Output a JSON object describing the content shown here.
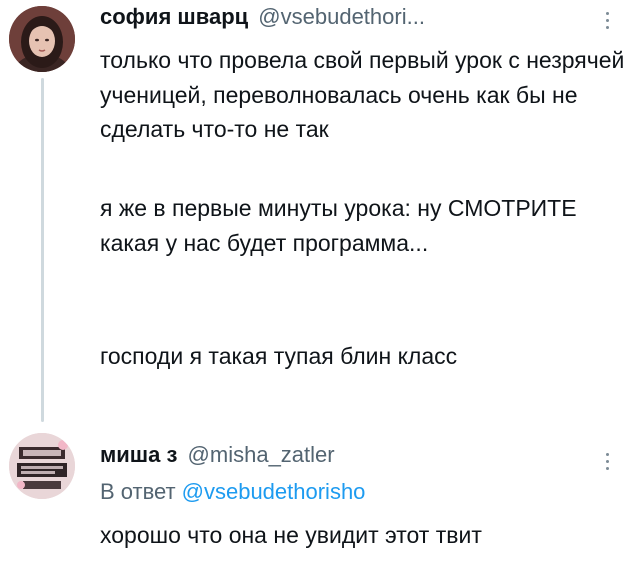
{
  "tweets": [
    {
      "author_name": "софия шварц",
      "author_handle": "@vsebudethori...",
      "paragraphs": [
        "только что провела свой первый урок с незрячей ученицей, переволновалась очень как бы не сделать что-то не так",
        "я же в первые минуты урока: ну СМОТРИТЕ какая у нас будет программа...",
        "господи я такая тупая блин класс"
      ]
    },
    {
      "author_name": "миша з",
      "author_handle": "@misha_zatler",
      "reply_prefix": "В ответ",
      "reply_to_handle": "@vsebudethorisho",
      "text": "хорошо что она не увидит этот твит"
    }
  ],
  "icons": {
    "more": "more-options-icon",
    "avatar1": "avatar",
    "avatar2": "avatar"
  },
  "colors": {
    "text": "#0f1419",
    "secondary": "#536471",
    "link": "#1d9bf0",
    "thread_line": "#cfd9de"
  }
}
